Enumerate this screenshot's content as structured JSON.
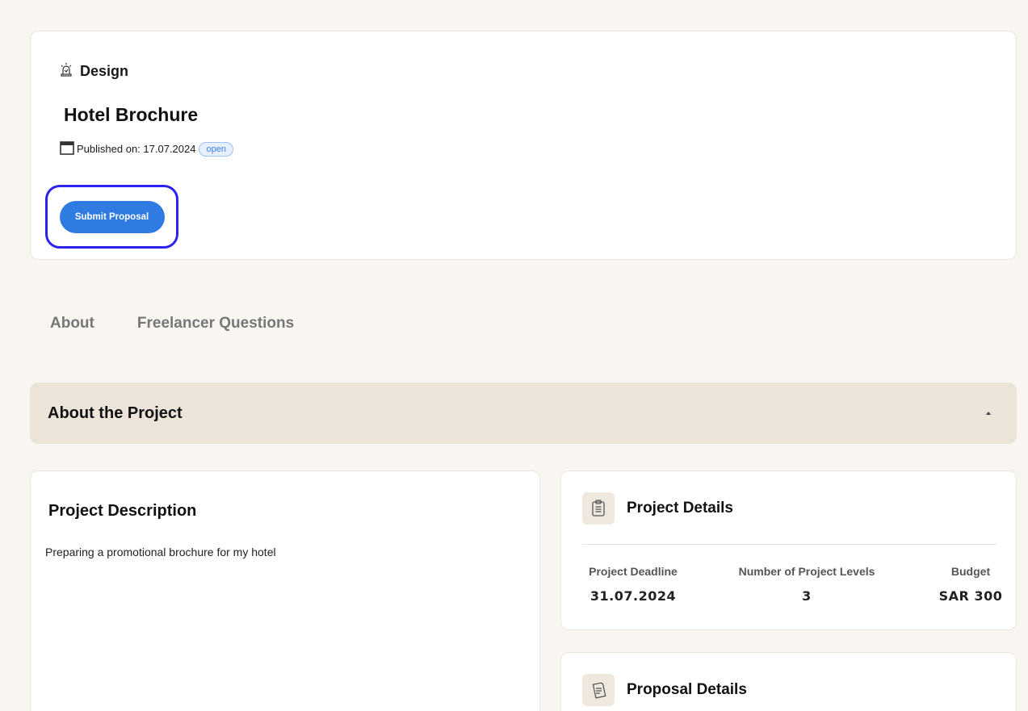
{
  "project": {
    "category": "Design",
    "title": "Hotel Brochure",
    "published_label": "Published on: 17.07.2024",
    "status": "open",
    "submit_label": "Submit Proposal"
  },
  "tabs": [
    {
      "label": "About"
    },
    {
      "label": "Freelancer Questions"
    }
  ],
  "accordion": {
    "title": "About the Project"
  },
  "description": {
    "title": "Project Description",
    "text": "Preparing a promotional brochure for my hotel"
  },
  "details": {
    "title": "Project Details",
    "deadline_label": "Project Deadline",
    "deadline_value": "31.07.2024",
    "levels_label": "Number of Project Levels",
    "levels_value": "3",
    "budget_label": "Budget",
    "budget_value": "SAR 300"
  },
  "proposal": {
    "title": "Proposal Details"
  },
  "colors": {
    "accent": "#2f7be2",
    "focus_ring": "#2b22f0",
    "accordion_bg": "#ece4d9",
    "page_bg": "#f9f6f2"
  },
  "icons": [
    "siren-icon",
    "calendar-icon",
    "clipboard-icon",
    "proposal-doc-icon",
    "caret-up-icon"
  ]
}
